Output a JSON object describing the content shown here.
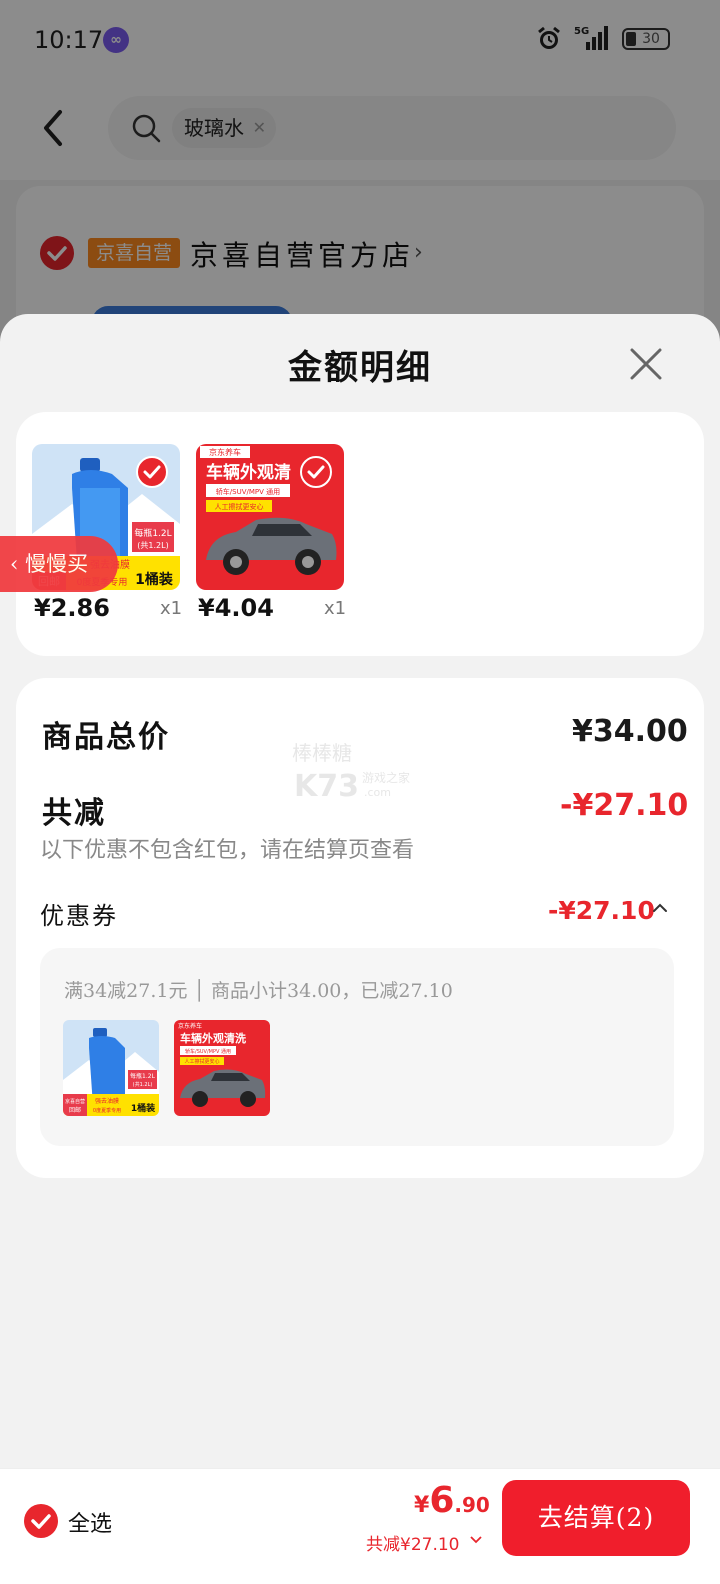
{
  "status": {
    "time": "10:17",
    "battery": "30",
    "network": "5G"
  },
  "search": {
    "query": "玻璃水"
  },
  "store": {
    "tag": "京喜自营",
    "name": "京喜自营官方店"
  },
  "sheet": {
    "title": "金额明细",
    "products": [
      {
        "price": "¥2.86",
        "qty": "x1",
        "image_text": [
          "每瓶1.2L",
          "(共1.2L)",
          "回邮",
          "强去油膜",
          "0度夏季专用",
          "1桶装"
        ]
      },
      {
        "price": "¥4.04",
        "qty": "x1",
        "image_text": [
          "京东养车",
          "车辆外观清",
          "轿车/SUV/MPV 通用",
          "人工擦拭更安心"
        ]
      }
    ],
    "summary": {
      "total_label": "商品总价",
      "total_value": "¥34.00",
      "discount_label": "共减",
      "discount_value": "-¥27.10",
      "note": "以下优惠不包含红包，请在结算页查看",
      "coupon_label": "优惠券",
      "coupon_value": "-¥27.10",
      "coupon_detail": "满34减27.1元 │ 商品小计34.00，已减27.10",
      "coupon_products": [
        {
          "image_text": [
            "每瓶1.2L",
            "(共1.2L)",
            "京喜自营",
            "回邮",
            "强去油膜",
            "0度夏季专用",
            "1桶装"
          ]
        },
        {
          "image_text": [
            "京东养车",
            "车辆外观清洗",
            "轿车/SUV/MPV 通用",
            "人工擦拭更安心"
          ]
        }
      ]
    },
    "float_button": "慢慢买"
  },
  "watermark": {
    "line1": "棒棒糖",
    "line2": "K73",
    "line3": "游戏之家",
    "line4": ".com"
  },
  "footer": {
    "select_all": "全选",
    "total_currency": "¥",
    "total_int": "6",
    "total_dec": ".90",
    "saved": "共减¥27.10",
    "checkout": "去结算(2)"
  },
  "colors": {
    "accent": "#e8262d",
    "tag": "#ff8a1f"
  }
}
